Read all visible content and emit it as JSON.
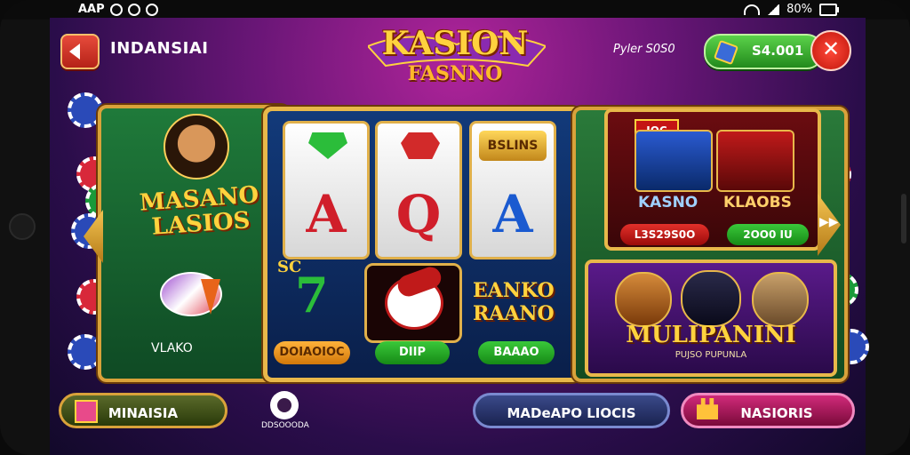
{
  "status_bar": {
    "left": "AAP",
    "right": "80%"
  },
  "header": {
    "app_name": "INDANSIAI",
    "logo_line1": "KASION",
    "logo_line2": "FASNNO",
    "player_label": "Pyler S0S0",
    "balance": "S4.001",
    "close_symbol": "✕"
  },
  "left_panel": {
    "title_line1": "MASANO",
    "title_line2": "LASIOS",
    "caption": "VLAKO"
  },
  "reels": {
    "row1": [
      "",
      "",
      "BSLINS"
    ],
    "row2": [
      "A",
      "Q",
      "A"
    ],
    "row3": [
      "SC",
      "",
      "EANKO"
    ],
    "row3_extra": "RAANO",
    "buttons": [
      "DOIAOIOC",
      "DIIP",
      "BAAAO"
    ]
  },
  "right_top_card": {
    "badge": "JOC",
    "label_left": "KASNO",
    "label_right": "KLAOBS",
    "btn_left": "L3S29S0O",
    "btn_right": "2OO0 IU"
  },
  "right_bottom_card": {
    "title": "MULIPANINI",
    "subtitle": "PUJSO PUPUNLA"
  },
  "arrow_right": "▶▶",
  "bottom": {
    "btn1": "MINAISIA",
    "q_label": "DDSOOODA",
    "btn2": "MADeAPO LIOCIS",
    "btn3": "NASIORIS"
  },
  "colors": {
    "accent_gold": "#e8b84a",
    "btn_green": "#2a9a2a",
    "btn_blue": "#2a3a7a",
    "btn_pink": "#b0185a"
  }
}
